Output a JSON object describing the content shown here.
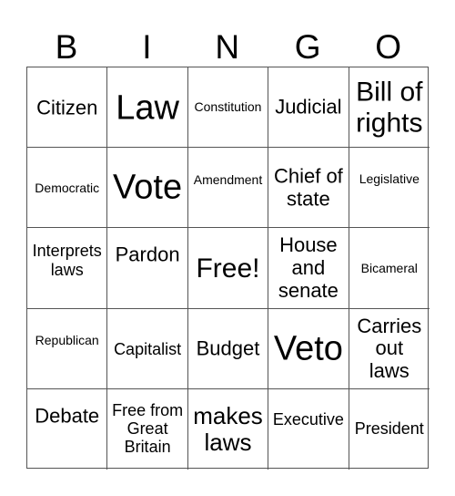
{
  "header": [
    "B",
    "I",
    "N",
    "G",
    "O"
  ],
  "cells": [
    [
      {
        "text": "Citizen",
        "size": "m"
      },
      {
        "text": "Law",
        "size": "xl"
      },
      {
        "text": "Constitution",
        "size": "s"
      },
      {
        "text": "Judicial",
        "size": "m"
      },
      {
        "text": "Bill of rights",
        "size": "l"
      }
    ],
    [
      {
        "text": "Democratic",
        "size": "s"
      },
      {
        "text": "Vote",
        "size": "xl"
      },
      {
        "text": "Amendment",
        "size": "s"
      },
      {
        "text": "Chief of state",
        "size": "m"
      },
      {
        "text": "Legislative",
        "size": "s"
      }
    ],
    [
      {
        "text": "Interprets laws",
        "size": "sm"
      },
      {
        "text": "Pardon",
        "size": "m"
      },
      {
        "text": "Free!",
        "size": "l"
      },
      {
        "text": "House and senate",
        "size": "m"
      },
      {
        "text": "Bicameral",
        "size": "s"
      }
    ],
    [
      {
        "text": "Republican",
        "size": "s"
      },
      {
        "text": "Capitalist",
        "size": "sm"
      },
      {
        "text": "Budget",
        "size": "m"
      },
      {
        "text": "Veto",
        "size": "xl"
      },
      {
        "text": "Carries out laws",
        "size": "m"
      }
    ],
    [
      {
        "text": "Debate",
        "size": "m"
      },
      {
        "text": "Free from Great Britain",
        "size": "sm"
      },
      {
        "text": "makes laws",
        "size": "ml"
      },
      {
        "text": "Executive",
        "size": "sm"
      },
      {
        "text": "President",
        "size": "sm"
      }
    ]
  ]
}
